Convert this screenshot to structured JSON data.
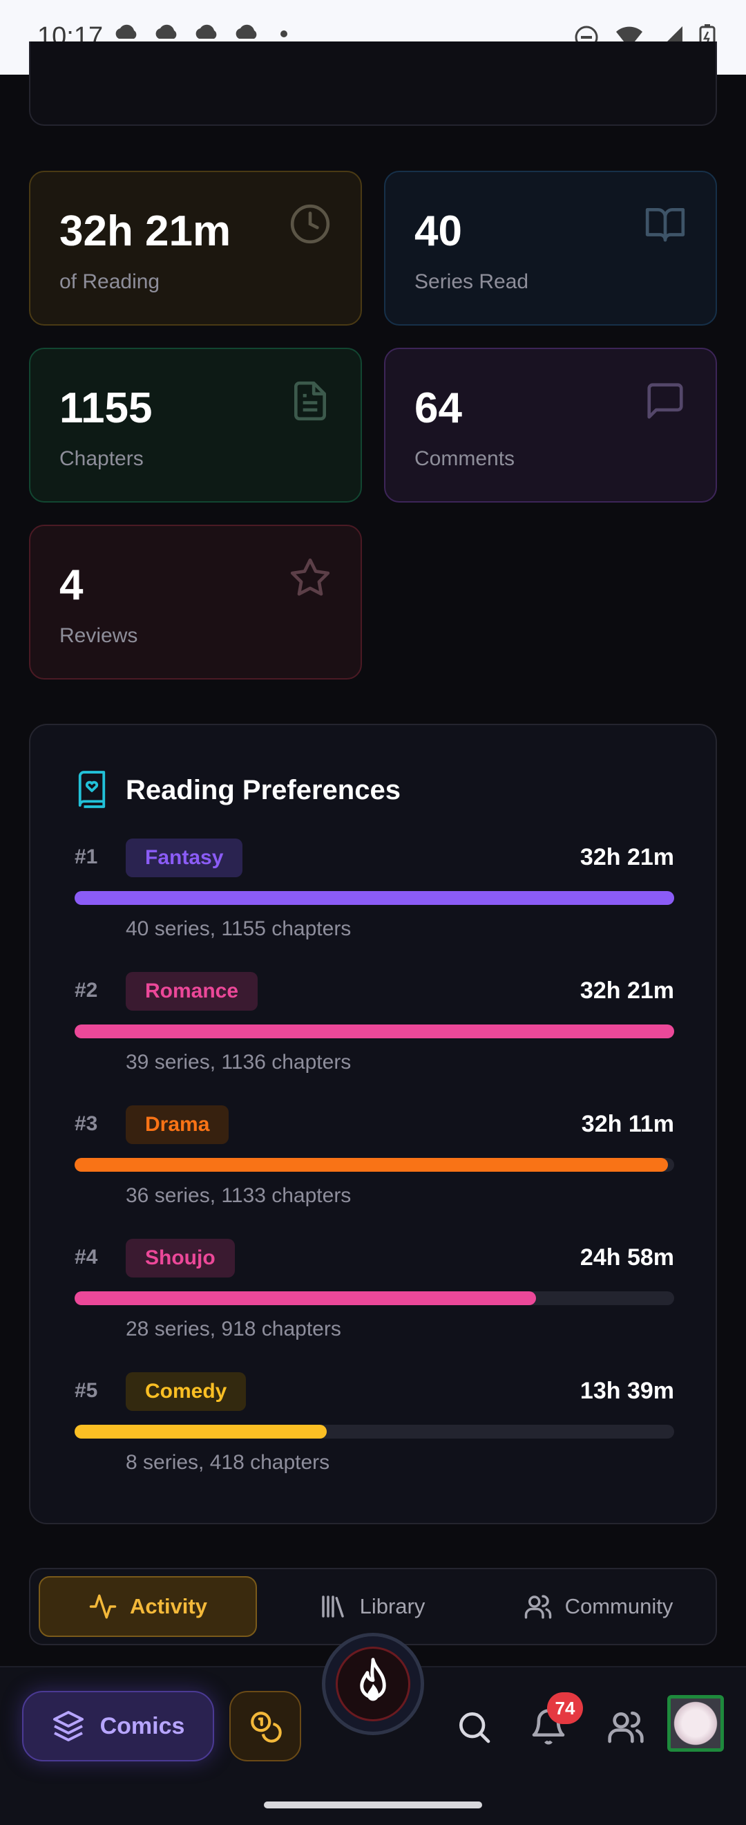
{
  "status_bar": {
    "time": "10:17"
  },
  "stats": {
    "reading": {
      "value": "32h 21m",
      "label": "of Reading",
      "icon": "clock-icon"
    },
    "series": {
      "value": "40",
      "label": "Series Read",
      "icon": "book-open-icon"
    },
    "chapters": {
      "value": "1155",
      "label": "Chapters",
      "icon": "document-icon"
    },
    "comments": {
      "value": "64",
      "label": "Comments",
      "icon": "chat-icon"
    },
    "reviews": {
      "value": "4",
      "label": "Reviews",
      "icon": "star-icon"
    }
  },
  "preferences": {
    "title": "Reading Preferences",
    "items": [
      {
        "rank": "#1",
        "genre": "Fantasy",
        "time": "32h 21m",
        "detail": "40 series, 1155 chapters",
        "fraction": 1.0,
        "color": "#8b5cf6",
        "chip_bg": "#2a2350"
      },
      {
        "rank": "#2",
        "genre": "Romance",
        "time": "32h 21m",
        "detail": "39 series, 1136 chapters",
        "fraction": 1.0,
        "color": "#ec4899",
        "chip_bg": "#3a1a30"
      },
      {
        "rank": "#3",
        "genre": "Drama",
        "time": "32h 11m",
        "detail": "36 series, 1133 chapters",
        "fraction": 0.99,
        "color": "#f97316",
        "chip_bg": "#37210f"
      },
      {
        "rank": "#4",
        "genre": "Shoujo",
        "time": "24h 58m",
        "detail": "28 series, 918 chapters",
        "fraction": 0.77,
        "color": "#ec4899",
        "chip_bg": "#3a1a30"
      },
      {
        "rank": "#5",
        "genre": "Comedy",
        "time": "13h 39m",
        "detail": "8 series, 418 chapters",
        "fraction": 0.42,
        "color": "#fbbf24",
        "chip_bg": "#33290f"
      }
    ]
  },
  "tabs": [
    {
      "label": "Activity",
      "icon": "activity-icon",
      "active": true
    },
    {
      "label": "Library",
      "icon": "library-icon",
      "active": false
    },
    {
      "label": "Community",
      "icon": "users-icon",
      "active": false
    }
  ],
  "bottom_nav": {
    "comics_label": "Comics",
    "notification_count": "74"
  }
}
